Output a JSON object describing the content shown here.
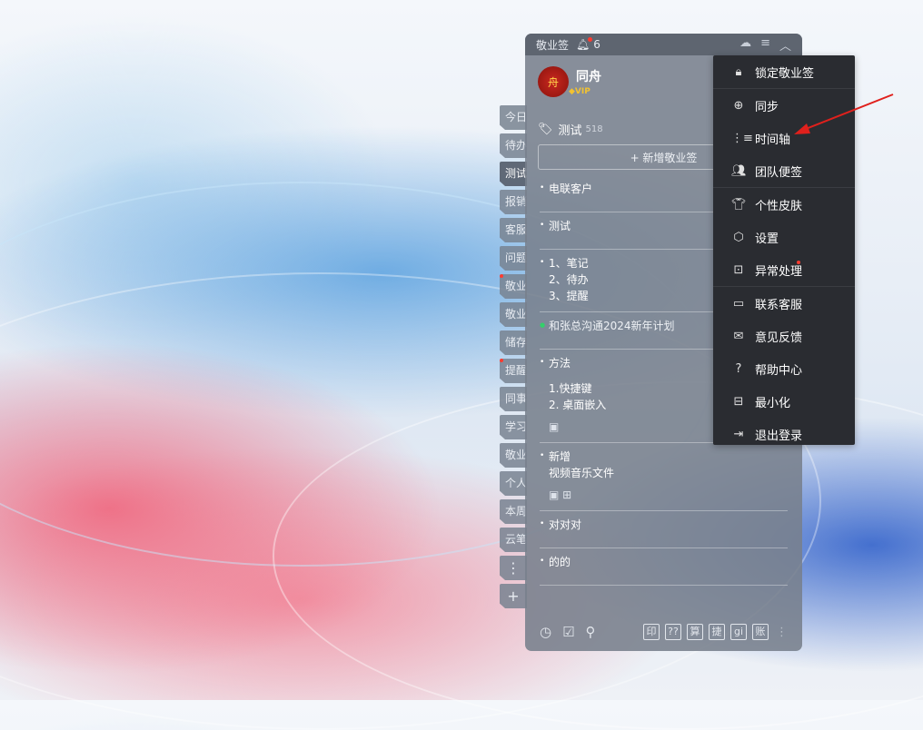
{
  "window": {
    "app_title": "敬业签",
    "notification_count": "6"
  },
  "profile": {
    "name": "同舟",
    "badge": "VIP",
    "avatar_text": "舟"
  },
  "side_tabs": [
    {
      "label": "今日"
    },
    {
      "label": "待办"
    },
    {
      "label": "测试",
      "active": true
    },
    {
      "label": "报销"
    },
    {
      "label": "客服"
    },
    {
      "label": "问题"
    },
    {
      "label": "敬业",
      "dot": true
    },
    {
      "label": "敬业"
    },
    {
      "label": "储存"
    },
    {
      "label": "提醒",
      "dot": true
    },
    {
      "label": "同事"
    },
    {
      "label": "学习"
    },
    {
      "label": "敬业"
    },
    {
      "label": "个人"
    },
    {
      "label": "本周"
    },
    {
      "label": "云笔"
    }
  ],
  "side_controls": {
    "more": "⋮",
    "add": "+"
  },
  "section": {
    "title": "测试",
    "count": "518",
    "new_button": "+ 新增敬业签"
  },
  "notes": [
    {
      "lines": [
        "电联客户"
      ]
    },
    {
      "lines": [
        "测试"
      ]
    },
    {
      "lines": [
        "1、笔记",
        "2、待办",
        "3、提醒"
      ]
    },
    {
      "lines": [
        "和张总沟通2024新年计划"
      ],
      "green": true
    },
    {
      "lines": [
        "方法",
        "",
        "1.快捷键",
        "2. 桌面嵌入"
      ],
      "attach": "▣"
    },
    {
      "lines": [
        "新增",
        "视频音乐文件"
      ],
      "attach": "▣ ⊞"
    },
    {
      "lines": [
        "对对对"
      ]
    },
    {
      "lines": [
        "的的"
      ]
    }
  ],
  "footer": {
    "left_icons": [
      "clock-icon",
      "check-box-icon",
      "search-icon"
    ],
    "tools": [
      "印",
      "??",
      "算",
      "捷",
      "gi",
      "账"
    ]
  },
  "menu": {
    "items": [
      {
        "label": "锁定敬业签",
        "icon": "lock-icon"
      },
      {
        "label": "同步",
        "icon": "sync-icon"
      },
      {
        "label": "时间轴",
        "icon": "timeline-icon"
      },
      {
        "label": "团队便签",
        "icon": "team-icon"
      },
      {
        "label": "个性皮肤",
        "icon": "shirt-icon"
      },
      {
        "label": "设置",
        "icon": "settings-icon"
      },
      {
        "label": "异常处理",
        "icon": "repair-icon",
        "dot": true
      },
      {
        "label": "联系客服",
        "icon": "chat-icon"
      },
      {
        "label": "意见反馈",
        "icon": "mail-icon"
      },
      {
        "label": "帮助中心",
        "icon": "help-icon"
      },
      {
        "label": "最小化",
        "icon": "minimize-icon"
      },
      {
        "label": "退出登录",
        "icon": "logout-icon"
      }
    ]
  },
  "colors": {
    "accent_red": "#ff3b30",
    "menu_bg": "#2a2c31",
    "arrow": "#e0201c"
  }
}
